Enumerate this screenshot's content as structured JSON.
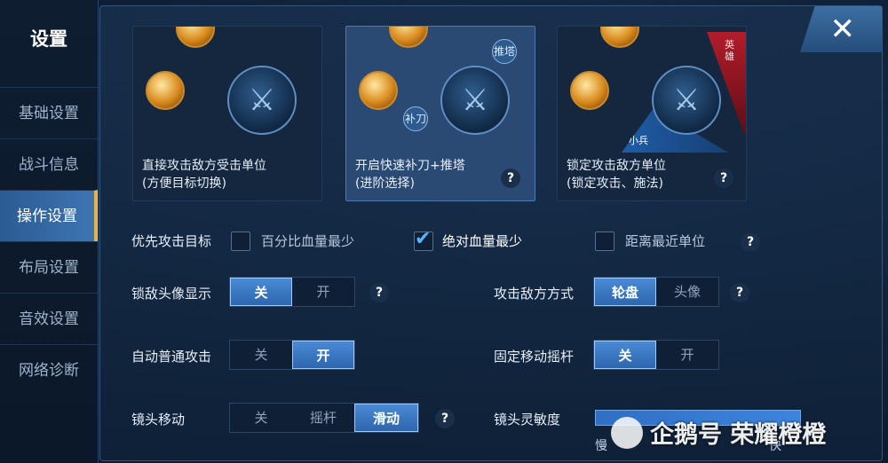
{
  "sidebar": {
    "title": "设置",
    "items": [
      {
        "label": "基础设置"
      },
      {
        "label": "战斗信息"
      },
      {
        "label": "操作设置"
      },
      {
        "label": "布局设置"
      },
      {
        "label": "音效设置"
      },
      {
        "label": "网络诊断"
      }
    ],
    "active_index": 2
  },
  "close": {
    "symbol": "✕"
  },
  "cards": [
    {
      "line1": "直接攻击敌方受击单位",
      "line2": "(方便目标切换)",
      "selected": false
    },
    {
      "line1": "开启快速补刀+推塔",
      "line2": "(进阶选择)",
      "selected": true,
      "help": "?",
      "badge1": "推塔",
      "badge2": "补刀"
    },
    {
      "line1": "锁定攻击敌方单位",
      "line2": "(锁定攻击、施法)",
      "selected": false,
      "help": "?",
      "hero_label": "英雄",
      "minion_label": "小兵"
    }
  ],
  "priority": {
    "label": "优先攻击目标",
    "options": [
      {
        "label": "百分比血量最少",
        "checked": false
      },
      {
        "label": "绝对血量最少",
        "checked": true
      },
      {
        "label": "距离最近单位",
        "checked": false
      }
    ],
    "help": "?"
  },
  "lock_avatar": {
    "label": "锁敌头像显示",
    "options": [
      "关",
      "开"
    ],
    "selected": 0,
    "help": "?"
  },
  "attack_mode": {
    "label": "攻击敌方方式",
    "options": [
      "轮盘",
      "头像"
    ],
    "selected": 0,
    "help": "?"
  },
  "auto_attack": {
    "label": "自动普通攻击",
    "options": [
      "关",
      "开"
    ],
    "selected": 1
  },
  "fixed_joystick": {
    "label": "固定移动摇杆",
    "options": [
      "关",
      "开"
    ],
    "selected": 0
  },
  "camera_move": {
    "label": "镜头移动",
    "options": [
      "关",
      "摇杆",
      "滑动"
    ],
    "selected": 2,
    "help": "?"
  },
  "camera_sensitivity": {
    "label": "镜头灵敏度",
    "slow": "慢",
    "fast": "快"
  },
  "watermark": {
    "text": "企鹅号 荣耀橙橙"
  },
  "colors": {
    "accent": "#3d75b3",
    "active_border": "#e6b24a",
    "checked": "#56b7ff"
  }
}
